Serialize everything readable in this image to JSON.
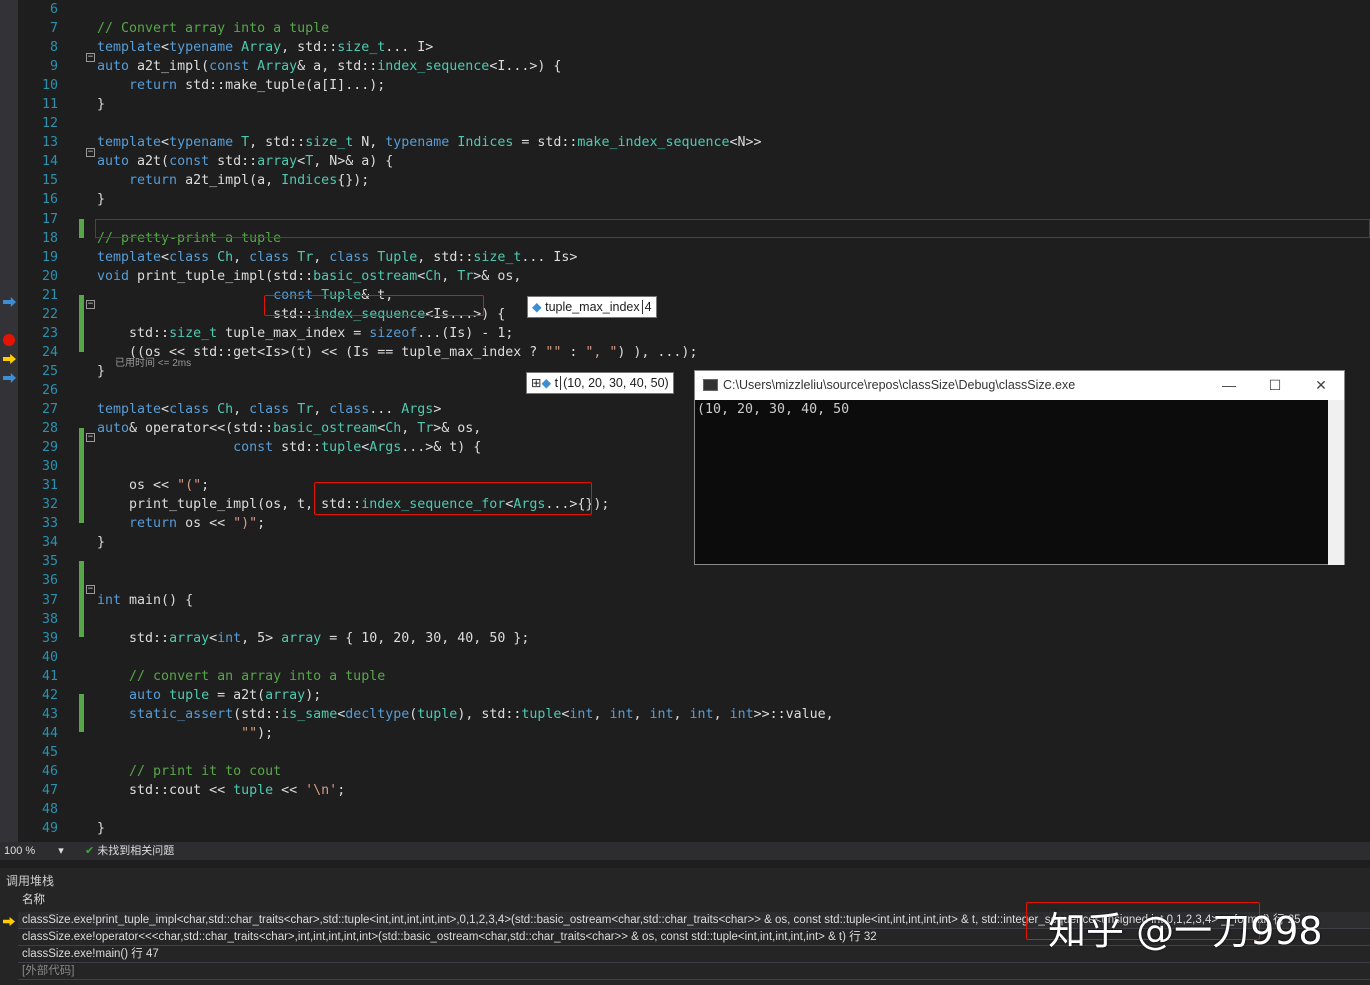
{
  "editor": {
    "first_line": 6,
    "lines": [
      "",
      "// Convert array into a tuple",
      "template<typename Array, std::size_t... I>",
      "auto a2t_impl(const Array& a, std::index_sequence<I...>) {",
      "    return std::make_tuple(a[I]...);",
      "}",
      "",
      "template<typename T, std::size_t N, typename Indices = std::make_index_sequence<N>>",
      "auto a2t(const std::array<T, N>& a) {",
      "    return a2t_impl(a, Indices{});",
      "}",
      "",
      "// pretty-print a tuple",
      "template<class Ch, class Tr, class Tuple, std::size_t... Is>",
      "void print_tuple_impl(std::basic_ostream<Ch, Tr>& os,",
      "                      const Tuple& t,",
      "                      std::index_sequence<Is...>) {",
      "    std::size_t tuple_max_index = sizeof...(Is) - 1;",
      "    ((os << std::get<Is>(t) << (Is == tuple_max_index ? \"\" : \", \") ), ...);",
      "}",
      "",
      "template<class Ch, class Tr, class... Args>",
      "auto& operator<<(std::basic_ostream<Ch, Tr>& os,",
      "                 const std::tuple<Args...>& t) {",
      "",
      "    os << \"(\";",
      "    print_tuple_impl(os, t, std::index_sequence_for<Args...>{});",
      "    return os << \")\";",
      "}",
      "",
      "",
      "int main() {",
      "",
      "    std::array<int, 5> array = { 10, 20, 30, 40, 50 };",
      "",
      "    // convert an array into a tuple",
      "    auto tuple = a2t(array);",
      "    static_assert(std::is_same<decltype(tuple), std::tuple<int, int, int, int, int>>::value,",
      "                  \"\");",
      "",
      "    // print it to cout",
      "    std::cout << tuple << '\\n';",
      "",
      "}"
    ],
    "elapsed_hint": "已用时间 <= 2ms"
  },
  "datatips": {
    "max_index": {
      "name": "tuple_max_index",
      "value": "4"
    },
    "t": {
      "name": "t",
      "value": "(10, 20, 30, 40, 50)"
    }
  },
  "console": {
    "title": "C:\\Users\\mizzleliu\\source\\repos\\classSize\\Debug\\classSize.exe",
    "output": "(10, 20, 30, 40, 50"
  },
  "status": {
    "zoom": "100 %",
    "issues": "未找到相关问题"
  },
  "callstack": {
    "title": "调用堆栈",
    "column": "名称",
    "rows": [
      "classSize.exe!print_tuple_impl<char,std::char_traits<char>,std::tuple<int,int,int,int,int>,0,1,2,3,4>(std::basic_ostream<char,std::char_traits<char>> & os, const std::tuple<int,int,int,int,int> & t, std::integer_sequence<unsigned int,0,1,2,3,4> __formal) 行 25",
      "classSize.exe!operator<<<char,std::char_traits<char>,int,int,int,int,int>(std::basic_ostream<char,std::char_traits<char>> & os, const std::tuple<int,int,int,int,int> & t) 行 32",
      "classSize.exe!main() 行 47",
      "[外部代码]"
    ]
  },
  "watermark": "知乎 @一刀998"
}
